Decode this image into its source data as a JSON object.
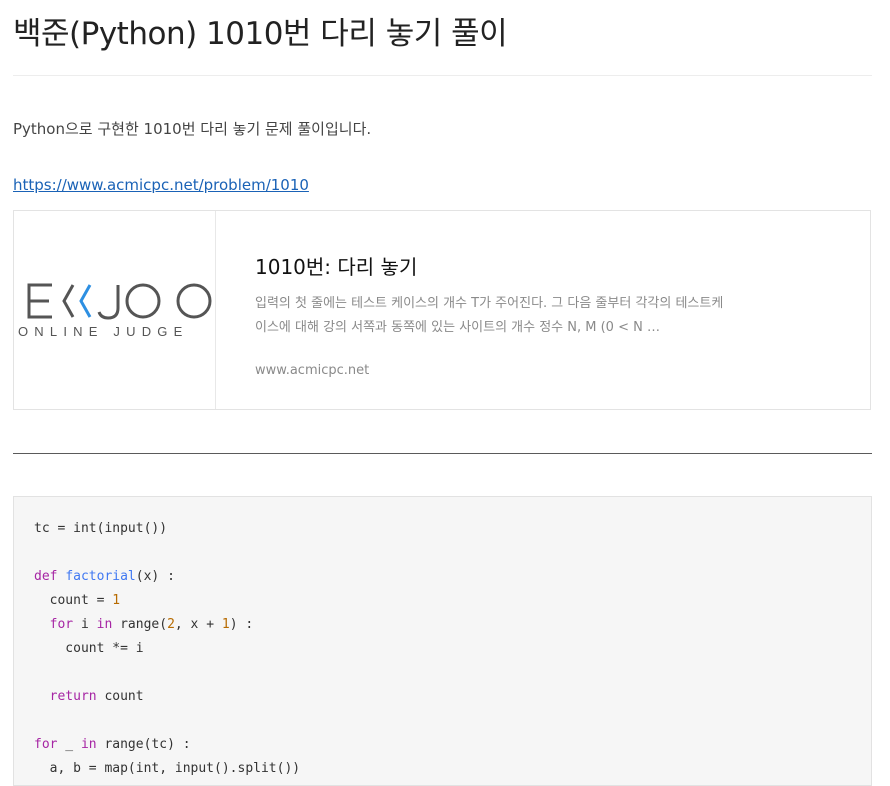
{
  "page": {
    "title": "백준(Python) 1010번 다리 놓기 풀이",
    "intro": "Python으로 구현한 1010번 다리 놓기 문제 풀이입니다.",
    "link": "https://www.acmicpc.net/problem/1010"
  },
  "card": {
    "logo_main": "EKJOO",
    "logo_sub": "ONLINE JUDGE",
    "title": "1010번: 다리 놓기",
    "description": "입력의 첫 줄에는 테스트 케이스의 개수 T가 주어진다. 그 다음 줄부터 각각의 테스트케이스에 대해 강의 서쪽과 동쪽에 있는 사이트의 개수 정수 N, M (0 < N …",
    "domain": "www.acmicpc.net",
    "colors": {
      "logo_dark": "#555555",
      "logo_accent": "#2d8fe2"
    }
  },
  "code": {
    "lines": [
      [
        {
          "t": "tc = int(input())"
        }
      ],
      [],
      [
        {
          "t": "def",
          "c": "kw"
        },
        {
          "t": " "
        },
        {
          "t": "factorial",
          "c": "fn"
        },
        {
          "t": "(x) :"
        }
      ],
      [
        {
          "t": "  count = "
        },
        {
          "t": "1",
          "c": "num"
        }
      ],
      [
        {
          "t": "  "
        },
        {
          "t": "for",
          "c": "kw"
        },
        {
          "t": " i "
        },
        {
          "t": "in",
          "c": "kw"
        },
        {
          "t": " range("
        },
        {
          "t": "2",
          "c": "num"
        },
        {
          "t": ", x + "
        },
        {
          "t": "1",
          "c": "num"
        },
        {
          "t": ") :"
        }
      ],
      [
        {
          "t": "    count *= i"
        }
      ],
      [],
      [
        {
          "t": "  "
        },
        {
          "t": "return",
          "c": "kw"
        },
        {
          "t": " count"
        }
      ],
      [],
      [
        {
          "t": "for",
          "c": "kw"
        },
        {
          "t": " _ "
        },
        {
          "t": "in",
          "c": "kw"
        },
        {
          "t": " range(tc) :"
        }
      ],
      [
        {
          "t": "  a, b = map(int, input().split())"
        }
      ]
    ]
  }
}
